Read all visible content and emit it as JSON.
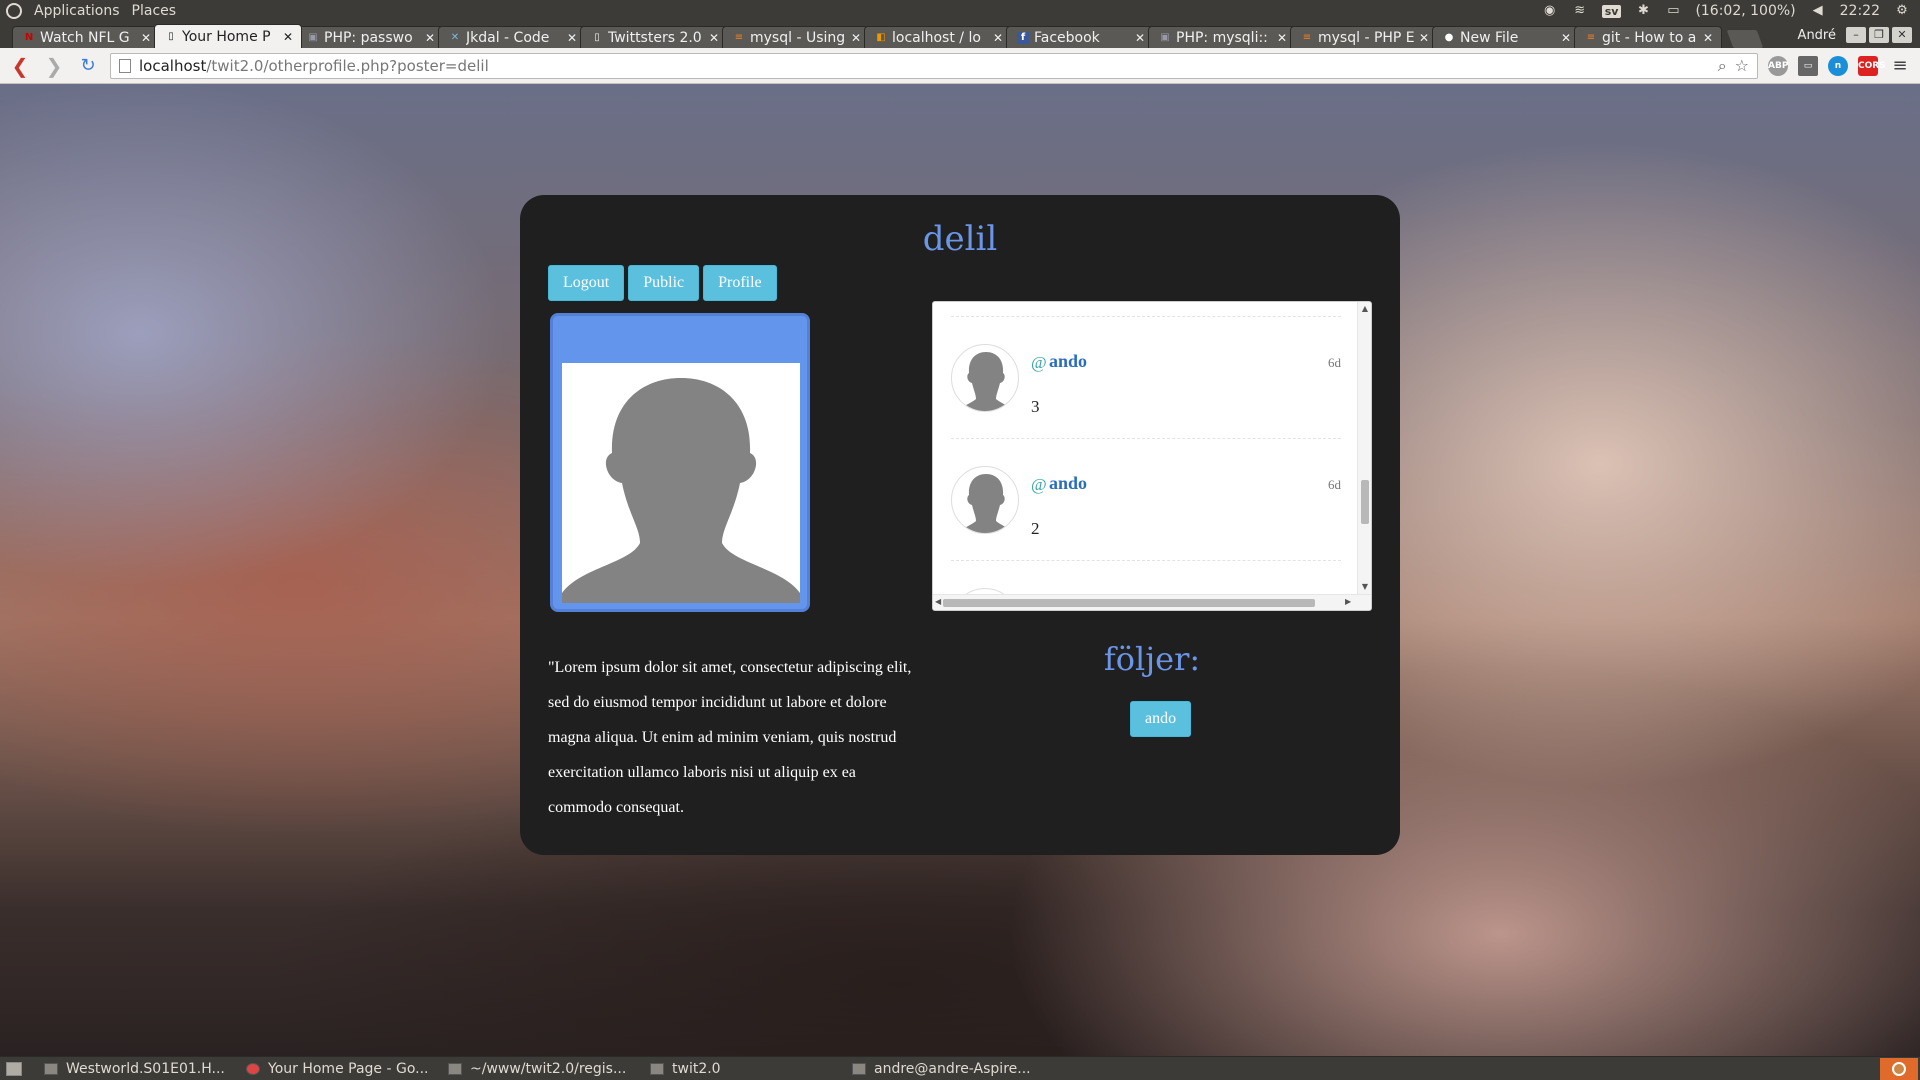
{
  "system_panel": {
    "menus": [
      "Applications",
      "Places"
    ],
    "language": "sv",
    "battery": "(16:02, 100%)",
    "clock": "22:22"
  },
  "browser": {
    "tabs": [
      {
        "title": "Watch NFL G",
        "favicon": "nfl-icon"
      },
      {
        "title": "Your Home P",
        "favicon": "page-icon",
        "active": true
      },
      {
        "title": "PHP: passwo",
        "favicon": "php-icon"
      },
      {
        "title": "Jkdal - Code",
        "favicon": "code-icon"
      },
      {
        "title": "Twittsters 2.0",
        "favicon": "page-icon"
      },
      {
        "title": "mysql - Using",
        "favicon": "stackoverflow-icon"
      },
      {
        "title": "localhost / lo",
        "favicon": "phpmyadmin-icon"
      },
      {
        "title": "Facebook",
        "favicon": "facebook-icon"
      },
      {
        "title": "PHP: mysqli::",
        "favicon": "php-icon"
      },
      {
        "title": "mysql - PHP E",
        "favicon": "stackoverflow-icon"
      },
      {
        "title": "New File",
        "favicon": "github-icon"
      },
      {
        "title": "git - How to a",
        "favicon": "stackoverflow-icon"
      }
    ],
    "profile_name": "André",
    "url_host": "localhost",
    "url_path": "/twit2.0/otherprofile.php?poster=delil"
  },
  "page": {
    "username": "delil",
    "nav_buttons": [
      "Logout",
      "Public",
      "Profile"
    ],
    "bio": "\"Lorem ipsum dolor sit amet, consectetur adipiscing elit, sed do eiusmod tempor incididunt ut labore et dolore magna aliqua. Ut enim ad minim veniam, quis nostrud exercitation ullamco laboris nisi ut aliquip ex ea commodo consequat.",
    "feed": [
      {
        "at": "@",
        "user": "ando",
        "time": "6d",
        "body": "3"
      },
      {
        "at": "@",
        "user": "ando",
        "time": "6d",
        "body": "2"
      }
    ],
    "following_title": "följer:",
    "following": [
      "ando"
    ],
    "colors": {
      "accent": "#6b95e6",
      "button": "#5bc0de",
      "card": "#1f1f1f"
    }
  },
  "taskbar": {
    "items": [
      "Westworld.S01E01.H...",
      "Your Home Page - Go...",
      "~/www/twit2.0/regis...",
      "twit2.0",
      "andre@andre-Aspire..."
    ]
  }
}
